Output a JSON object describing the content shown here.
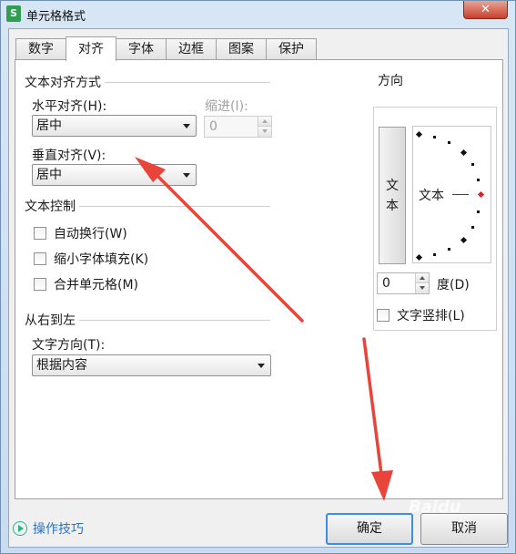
{
  "window": {
    "title": "单元格格式",
    "app_icon_letter": "S",
    "close_symbol": "✕"
  },
  "tabs": [
    {
      "label": "数字"
    },
    {
      "label": "对齐",
      "active": true
    },
    {
      "label": "字体"
    },
    {
      "label": "边框"
    },
    {
      "label": "图案"
    },
    {
      "label": "保护"
    }
  ],
  "alignment": {
    "group_title": "文本对齐方式",
    "horizontal_label": "水平对齐(H):",
    "horizontal_value": "居中",
    "indent_label": "缩进(I):",
    "indent_value": "0",
    "vertical_label": "垂直对齐(V):",
    "vertical_value": "居中"
  },
  "text_control": {
    "group_title": "文本控制",
    "wrap_label": "自动换行(W)",
    "shrink_label": "缩小字体填充(K)",
    "merge_label": "合并单元格(M)"
  },
  "rtl": {
    "group_title": "从右到左",
    "direction_label": "文字方向(T):",
    "direction_value": "根据内容"
  },
  "orientation": {
    "group_title": "方向",
    "vertical_text": [
      "文",
      "本"
    ],
    "dial_text": "文本",
    "degrees_value": "0",
    "degrees_label": "度(D)",
    "vertical_stack_label": "文字竖排(L)"
  },
  "footer": {
    "help_label": "操作技巧",
    "ok_label": "确定",
    "cancel_label": "取消",
    "watermark": "Baidu"
  },
  "colors": {
    "annotation_arrow": "#e8443a",
    "primary_button_border": "#3b8ee0"
  }
}
